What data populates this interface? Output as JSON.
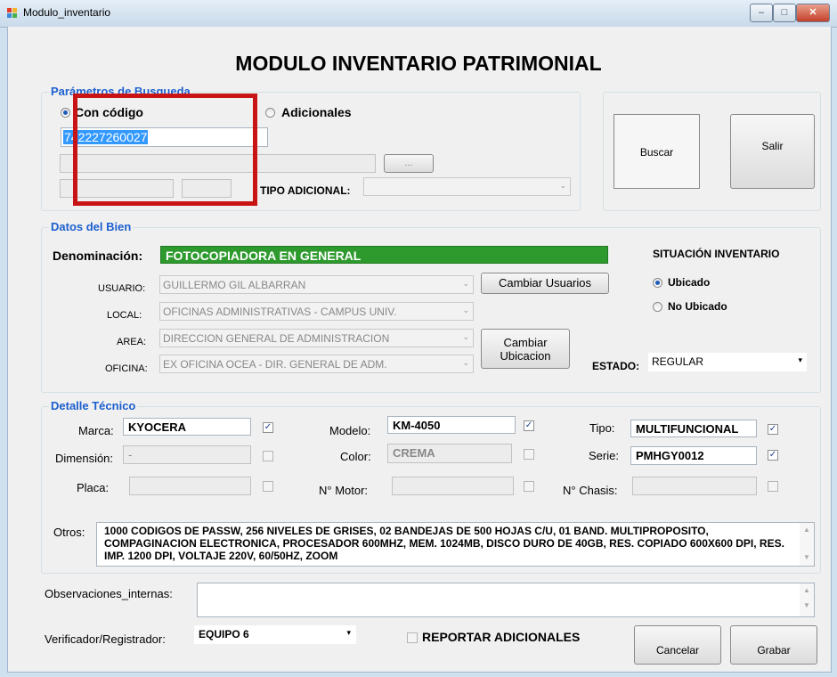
{
  "window": {
    "title": "Modulo_inventario",
    "minimize": "–",
    "maximize": "□",
    "close": "✕"
  },
  "main_title": "MODULO INVENTARIO PATRIMONIAL",
  "search": {
    "group_label": "Parámetros de Busqueda",
    "radio_code": "Con código",
    "radio_additional": "Adicionales",
    "code_value": "742227260027",
    "ellipsis_label": "...",
    "tipo_adicional_label": "TIPO ADICIONAL:"
  },
  "actions": {
    "search_label": "Buscar",
    "exit_label": "Salir"
  },
  "bien": {
    "group_label": "Datos del Bien",
    "denominacion_label": "Denominación:",
    "denominacion_value": "FOTOCOPIADORA EN GENERAL",
    "usuario_label": "USUARIO:",
    "usuario_value": "GUILLERMO GIL ALBARRAN",
    "local_label": "LOCAL:",
    "local_value": "OFICINAS ADMINISTRATIVAS - CAMPUS UNIV.",
    "area_label": "AREA:",
    "area_value": "DIRECCION GENERAL DE ADMINISTRACION",
    "oficina_label": "OFICINA:",
    "oficina_value": "EX OFICINA OCEA - DIR. GENERAL DE ADM.",
    "cambiar_usuarios": "Cambiar Usuarios",
    "cambiar_ubicacion_1": "Cambiar",
    "cambiar_ubicacion_2": "Ubicacion",
    "situacion_label": "SITUACIÓN INVENTARIO",
    "ubicado": "Ubicado",
    "no_ubicado": "No Ubicado",
    "estado_label": "ESTADO:",
    "estado_value": "REGULAR"
  },
  "tecnico": {
    "group_label": "Detalle Técnico",
    "marca_label": "Marca:",
    "marca_value": "KYOCERA",
    "modelo_label": "Modelo:",
    "modelo_value": "KM-4050",
    "tipo_label": "Tipo:",
    "tipo_value": "MULTIFUNCIONAL",
    "dimension_label": "Dimensión:",
    "dimension_value": "-",
    "color_label": "Color:",
    "color_value": "CREMA",
    "serie_label": "Serie:",
    "serie_value": "PMHGY0012",
    "placa_label": "Placa:",
    "motor_label": "N° Motor:",
    "chasis_label": "N° Chasis:",
    "otros_label": "Otros:",
    "otros_value": "1000 CODIGOS DE PASSW, 256 NIVELES DE GRISES, 02 BANDEJAS DE 500 HOJAS C/U, 01 BAND. MULTIPROPOSITO, COMPAGINACION ELECTRONICA, PROCESADOR 600MHZ, MEM. 1024MB, DISCO DURO DE 40GB, RES. COPIADO 600X600 DPI, RES. IMP. 1200 DPI, VOLTAJE 220V, 60/50HZ, ZOOM"
  },
  "footer": {
    "observaciones_label": "Observaciones_internas:",
    "verificador_label": "Verificador/Registrador:",
    "verificador_value": "EQUIPO 6",
    "reportar_label": "REPORTAR ADICIONALES",
    "cancel_label": "Cancelar",
    "save_label": "Grabar"
  },
  "colors": {
    "accent_green": "#2e9a2e",
    "group_label_blue": "#1c5fcf",
    "highlight_red": "#c81414",
    "selection_blue": "#3399ff"
  }
}
